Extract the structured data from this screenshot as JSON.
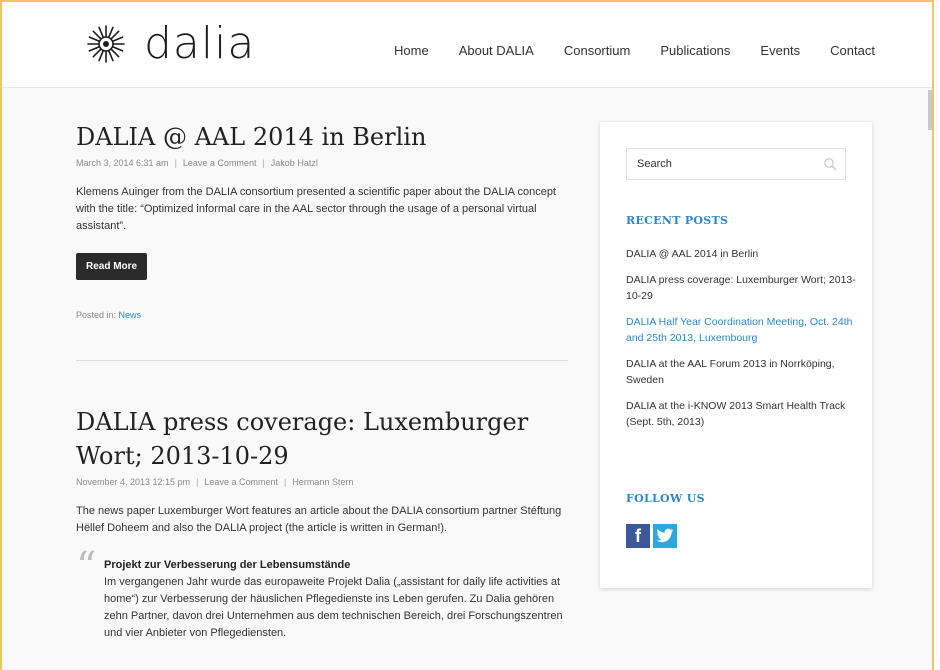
{
  "header": {
    "logo_text": "dalia",
    "nav": [
      "Home",
      "About DALIA",
      "Consortium",
      "Publications",
      "Events",
      "Contact"
    ]
  },
  "posts": [
    {
      "title": "DALIA @ AAL 2014 in Berlin",
      "date": "March 3, 2014 6:31 am",
      "comments": "Leave a Comment",
      "author": "Jakob Hatzl",
      "excerpt": "Klemens Auinger from the DALIA consortium presented a scientific paper about the DALIA concept with the title: “Optimized informal care in the AAL sector through the usage of a personal virtual assistant”.",
      "read_more": "Read More",
      "posted_in_label": "Posted in:",
      "category": "News"
    },
    {
      "title": "DALIA press coverage: Luxemburger Wort; 2013-10-29",
      "date": "November 4, 2013 12:15 pm",
      "comments": "Leave a Comment",
      "author": "Hermann Stern",
      "excerpt": "The news paper Luxemburger Wort features an article about the DALIA consortium partner Stéftung Hëllef Doheem and also the DALIA project (the article is written in German!).",
      "quote_title": "Projekt zur Verbesserung der Lebensumstände",
      "quote_body": "Im vergangenen Jahr wurde das europaweite Projekt Dalia („assistant for daily life activities at home“) zur Verbesserung der häuslichen Pflegedienste ins Leben gerufen. Zu Dalia gehören zehn Partner, davon drei Unternehmen aus dem technischen Bereich, drei Forschungszentren und vier Anbieter von Pflegediensten."
    }
  ],
  "sidebar": {
    "search_placeholder": "Search",
    "recent_title": "RECENT POSTS",
    "recent": [
      "DALIA @ AAL 2014 in Berlin",
      "DALIA press coverage: Luxemburger Wort; 2013-10-29",
      "DALIA Half Year Coordination Meeting, Oct. 24th and 25th 2013, Luxembourg",
      "DALIA at the AAL Forum 2013 in Norrköping, Sweden",
      "DALIA at the i-KNOW 2013 Smart Health Track (Sept. 5th, 2013)"
    ],
    "follow_title": "FOLLOW US",
    "facebook_glyph": "f",
    "social_icons": [
      "facebook-icon",
      "twitter-icon"
    ]
  },
  "colors": {
    "accent": "#2a88c9",
    "frame_border": "#f5c26b",
    "button": "#2b2b2b",
    "facebook": "#3b5998",
    "twitter": "#2ca7e0"
  }
}
